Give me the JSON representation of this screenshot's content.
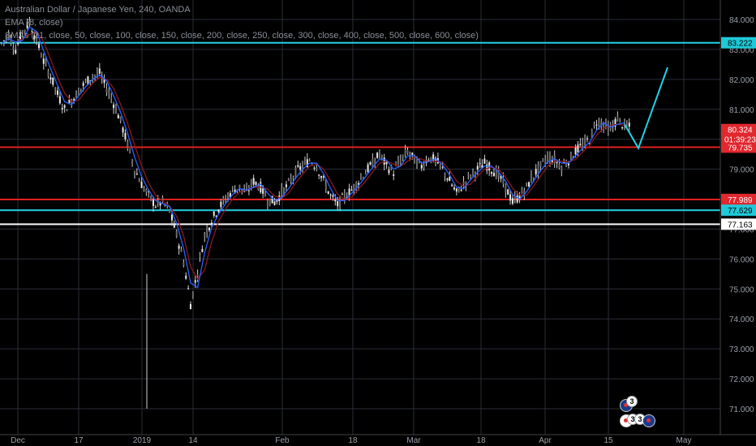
{
  "legend": {
    "title": "Australian Dollar / Japanese Yen, 240, OANDA",
    "ema": "EMA (8, close)",
    "smas": "SMAs (21, close, 50, close, 100, close, 150, close, 200, close, 250, close, 300, close, 400, close, 500, close, 600, close)"
  },
  "events": {
    "badge_top": "3",
    "badge_bottom_1": "3",
    "badge_bottom_2": "3"
  },
  "colors": {
    "background": "#000000",
    "grid": "#2a2e39",
    "up_candle": "#e8e8e8",
    "down_candle": "#e8e8e8",
    "ema": "#2962ff",
    "sma": "#8b1a1a",
    "red_level": "#e02020",
    "cyan_level": "#22d3e6",
    "white_level": "#ffffff",
    "price_label_red": "#e0282e",
    "price_label_cyan": "#20c9d8"
  },
  "chart_data": {
    "type": "line",
    "title": "Australian Dollar / Japanese Yen, 240, OANDA",
    "ylim": [
      70.5,
      84.5
    ],
    "x_ticks": [
      "Dec",
      "17",
      "2019",
      "14",
      "Feb",
      "18",
      "Mar",
      "18",
      "Apr",
      "15",
      "May"
    ],
    "y_ticks": [
      "84.000",
      "83.000",
      "82.000",
      "81.000",
      "80.000",
      "79.000",
      "78.000",
      "77.000",
      "76.000",
      "75.000",
      "74.000",
      "73.000",
      "72.000",
      "71.000"
    ],
    "levels": [
      {
        "price": 83.222,
        "label": "83.222",
        "color": "cyan"
      },
      {
        "price": 79.735,
        "label": "79.735",
        "color": "red"
      },
      {
        "price": 77.989,
        "label": "77.989",
        "color": "red"
      },
      {
        "price": 77.629,
        "label": "77.629",
        "color": "cyan"
      },
      {
        "price": 77.163,
        "label": "77.163",
        "color": "white"
      }
    ],
    "last_price": {
      "price": 80.324,
      "label": "80.324",
      "countdown": "01:39:23"
    },
    "price_path": [
      83.2,
      83.5,
      83.0,
      83.6,
      83.9,
      83.3,
      82.6,
      82.1,
      81.5,
      81.0,
      81.3,
      81.6,
      81.9,
      82.1,
      82.2,
      81.7,
      81.2,
      80.6,
      79.8,
      79.0,
      78.5,
      78.1,
      77.8,
      77.9,
      77.6,
      76.8,
      75.9,
      74.5,
      75.6,
      76.8,
      77.3,
      77.7,
      78.0,
      78.3,
      78.4,
      78.2,
      78.6,
      78.4,
      78.0,
      77.9,
      78.2,
      78.5,
      78.9,
      79.1,
      79.3,
      79.1,
      78.6,
      78.1,
      77.8,
      78.1,
      78.3,
      78.6,
      78.9,
      79.2,
      79.5,
      79.1,
      78.9,
      79.3,
      79.6,
      79.3,
      79.1,
      79.4,
      79.3,
      79.0,
      78.6,
      78.2,
      78.5,
      78.8,
      79.0,
      79.2,
      79.0,
      78.8,
      78.4,
      77.9,
      78.1,
      78.4,
      78.8,
      79.1,
      79.4,
      79.3,
      79.1,
      79.3,
      79.6,
      79.8,
      80.0,
      80.6,
      80.5,
      80.3,
      80.7,
      80.4
    ],
    "projection": [
      {
        "x": "2019-04-17",
        "y": 80.5
      },
      {
        "x": "2019-04-19",
        "y": 79.7
      },
      {
        "x": "2019-04-28",
        "y": 82.4
      }
    ]
  }
}
